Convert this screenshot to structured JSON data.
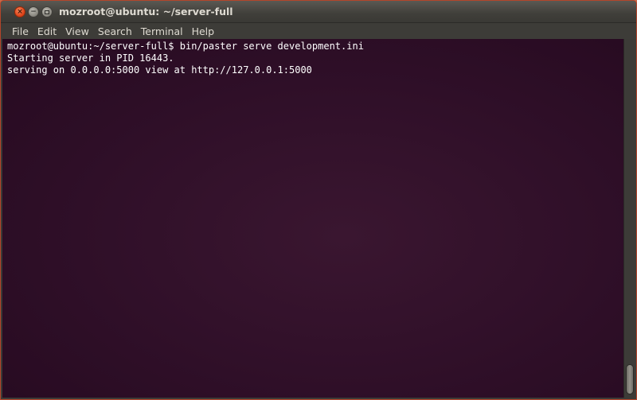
{
  "window": {
    "title": "mozroot@ubuntu: ~/server-full",
    "buttons": {
      "close_glyph": "×",
      "minimize_glyph": "−"
    }
  },
  "menu": [
    "File",
    "Edit",
    "View",
    "Search",
    "Terminal",
    "Help"
  ],
  "terminal": {
    "lines": [
      "mozroot@ubuntu:~/server-full$ bin/paster serve development.ini",
      "Starting server in PID 16443.",
      "serving on 0.0.0.0:5000 view at http://127.0.0.1:5000"
    ]
  },
  "colors": {
    "terminal_background": "#300a24",
    "terminal_text": "#ffffff",
    "close_button": "#e0461c",
    "chrome": "#3c3b37"
  },
  "scroll": {
    "position_fraction": 1.0
  }
}
